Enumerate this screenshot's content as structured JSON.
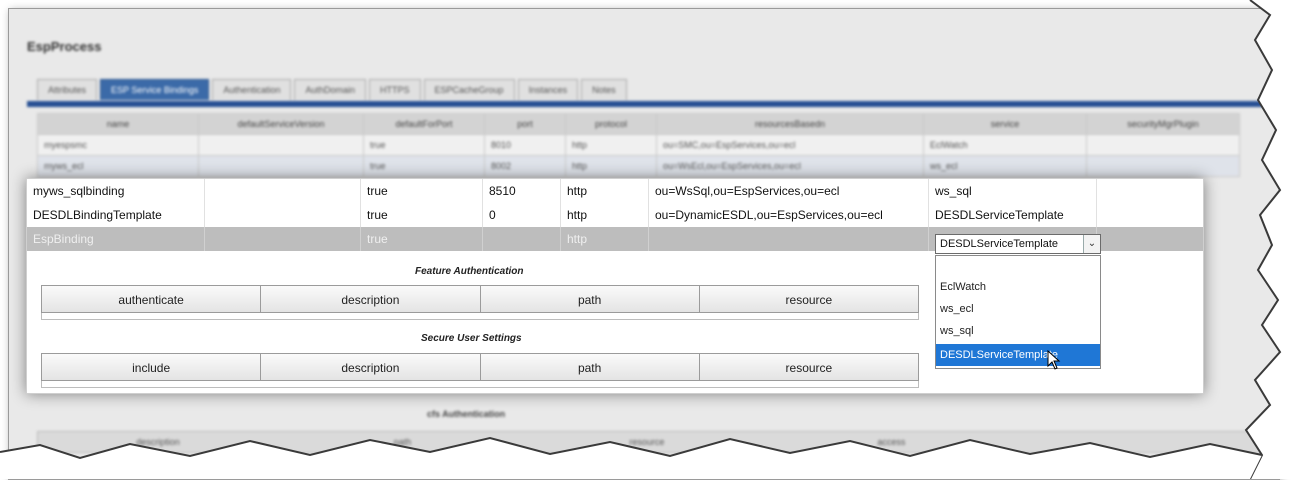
{
  "background_window": {
    "title": "EspProcess",
    "tabs": [
      "Attributes",
      "ESP Service Bindings",
      "Authentication",
      "AuthDomain",
      "HTTPS",
      "ESPCacheGroup",
      "Instances",
      "Notes"
    ],
    "active_tab": 1,
    "table_headers": [
      "name",
      "defaultServiceVersion",
      "defaultForPort",
      "port",
      "protocol",
      "resourcesBasedn",
      "service",
      "securityMgrPlugin"
    ],
    "rows": [
      [
        "myespsmc",
        "",
        "true",
        "8010",
        "http",
        "ou=SMC,ou=EspServices,ou=ecl",
        "EclWatch",
        ""
      ],
      [
        "myws_ecl",
        "",
        "true",
        "8002",
        "http",
        "ou=WsEcl,ou=EspServices,ou=ecl",
        "ws_ecl",
        ""
      ]
    ],
    "section_label": "cfs Authentication",
    "bottom_headers": [
      "description",
      "path",
      "resource",
      "access"
    ]
  },
  "popup": {
    "rows": [
      {
        "name": "myws_sqlbinding",
        "defaultServiceVersion": "",
        "defaultForPort": "true",
        "port": "8510",
        "protocol": "http",
        "resourcesBasedn": "ou=WsSql,ou=EspServices,ou=ecl",
        "service": "ws_sql"
      },
      {
        "name": "DESDLBindingTemplate",
        "defaultServiceVersion": "",
        "defaultForPort": "true",
        "port": "0",
        "protocol": "http",
        "resourcesBasedn": "ou=DynamicESDL,ou=EspServices,ou=ecl",
        "service": "DESDLServiceTemplate"
      },
      {
        "name": "EspBinding",
        "defaultServiceVersion": "",
        "defaultForPort": "true",
        "port": "",
        "protocol": "http",
        "resourcesBasedn": "",
        "service": ""
      }
    ],
    "feature_auth": {
      "title": "Feature Authentication",
      "headers": [
        "authenticate",
        "description",
        "path",
        "resource"
      ]
    },
    "secure_user": {
      "title": "Secure User Settings",
      "headers": [
        "include",
        "description",
        "path",
        "resource"
      ]
    },
    "dropdown": {
      "selected": "DESDLServiceTemplate",
      "options": [
        "",
        "EclWatch",
        "ws_ecl",
        "ws_sql",
        "DESDLServiceTemplate"
      ],
      "highlighted_index": 4
    }
  }
}
